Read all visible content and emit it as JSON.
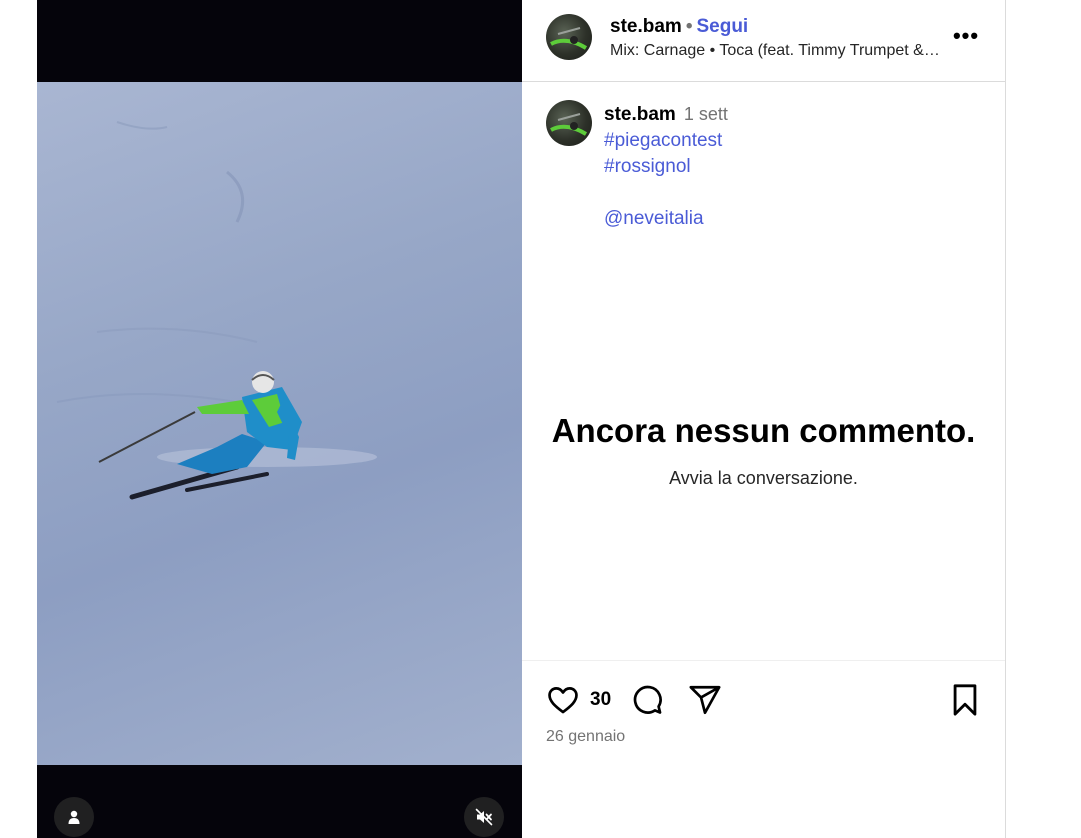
{
  "post": {
    "username": "ste.bam",
    "follow_label": "Segui",
    "audio": "Mix: Carnage • Toca (feat. Timmy Trumpet & KSHMR)",
    "more_label": "•••"
  },
  "caption": {
    "username": "ste.bam",
    "time": "1 sett",
    "lines": [
      "#piegacontest",
      "#rossignol",
      "",
      "@neveitalia"
    ]
  },
  "comments": {
    "empty_title": "Ancora nessun commento.",
    "empty_subtitle": "Avvia la conversazione."
  },
  "actions": {
    "like_count": "30",
    "date": "26 gennaio"
  },
  "icons": {
    "like": "heart-icon",
    "comment": "comment-icon",
    "share": "share-icon",
    "save": "bookmark-icon",
    "user": "user-icon",
    "mute": "muted-speaker-icon",
    "more": "more-icon"
  },
  "colors": {
    "link": "#4a5bd6",
    "muted_text": "#737373",
    "video_letterbox": "#05040b",
    "snow": "#97a7c7",
    "skier_jacket": "#1f8ec9",
    "skier_accent": "#5dcc3a"
  }
}
